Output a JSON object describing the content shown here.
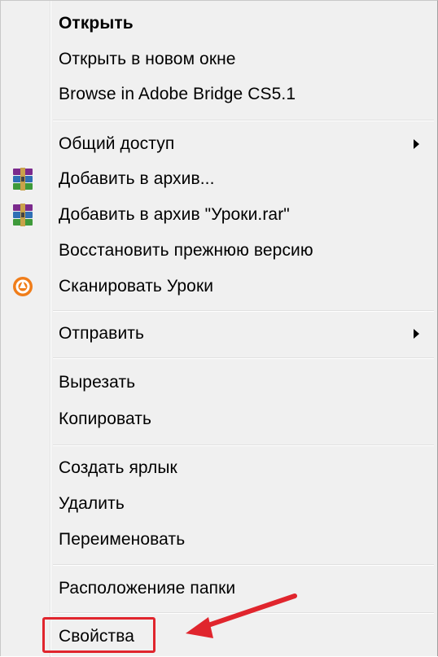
{
  "menu": {
    "items": [
      {
        "label": "Открыть",
        "bold": true,
        "icon": null,
        "submenu": false
      },
      {
        "label": "Открыть в новом окне",
        "bold": false,
        "icon": null,
        "submenu": false
      },
      {
        "label": "Browse in Adobe Bridge CS5.1",
        "bold": false,
        "icon": null,
        "submenu": false
      },
      {
        "label": "Общий доступ",
        "bold": false,
        "icon": null,
        "submenu": true
      },
      {
        "label": "Добавить в архив...",
        "bold": false,
        "icon": "winrar-icon",
        "submenu": false
      },
      {
        "label": "Добавить в архив \"Уроки.rar\"",
        "bold": false,
        "icon": "winrar-icon",
        "submenu": false
      },
      {
        "label": "Восстановить прежнюю версию",
        "bold": false,
        "icon": null,
        "submenu": false
      },
      {
        "label": "Сканировать Уроки",
        "bold": false,
        "icon": "avast-icon",
        "submenu": false
      },
      {
        "label": "Отправить",
        "bold": false,
        "icon": null,
        "submenu": true
      },
      {
        "label": "Вырезать",
        "bold": false,
        "icon": null,
        "submenu": false
      },
      {
        "label": "Копировать",
        "bold": false,
        "icon": null,
        "submenu": false
      },
      {
        "label": "Создать ярлык",
        "bold": false,
        "icon": null,
        "submenu": false
      },
      {
        "label": "Удалить",
        "bold": false,
        "icon": null,
        "submenu": false
      },
      {
        "label": "Переименовать",
        "bold": false,
        "icon": null,
        "submenu": false
      },
      {
        "label": "Расположенияе папки",
        "bold": false,
        "icon": null,
        "submenu": false
      },
      {
        "label": "Свойства",
        "bold": false,
        "icon": null,
        "submenu": false
      }
    ]
  },
  "annotation": {
    "highlight_color": "#e0252d",
    "highlighted_item": "Свойства"
  },
  "colors": {
    "menu_background": "#f0f0f0",
    "separator": "#e0e0e0"
  }
}
